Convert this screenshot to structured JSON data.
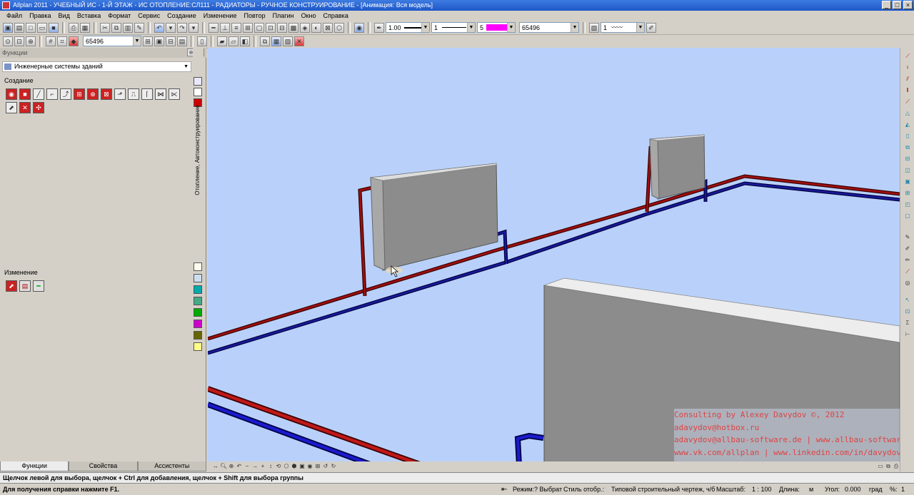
{
  "window": {
    "title": "Allplan 2011 - УЧЕБНЫЙ ИС - 1-Й ЭТАЖ - ИС ОТОПЛЕНИЕ:СЛ111 - РАДИАТОРЫ - РУЧНОЕ КОНСТРУИРОВАНИЕ - [Анимация: Вся модель]",
    "minimize": "_",
    "maximize": "□",
    "close": "×"
  },
  "menu": [
    "Файл",
    "Правка",
    "Вид",
    "Вставка",
    "Формат",
    "Сервис",
    "Создание",
    "Изменение",
    "Повтор",
    "Плагин",
    "Окно",
    "Справка"
  ],
  "toolbar1": {
    "pen_thickness": "1.00",
    "line_type": "1",
    "color_index": "5",
    "layer_value": "65496",
    "hatch_value": "1",
    "color_swatch": "#ff00ff"
  },
  "toolbar2": {
    "fixed_value": "65496"
  },
  "panel": {
    "header": "Функции",
    "module": "Инженерные системы зданий",
    "section_create": "Создание",
    "section_modify": "Изменение",
    "vertical_tab": "Отопление, Автоконструирование"
  },
  "bottom_tabs": [
    "Функции",
    "Свойства",
    "Ассистенты"
  ],
  "prompt": "Щелчок левой для выбора, щелчок + Ctrl для добавления, щелчок + Shift для выбора группы",
  "status": {
    "help": "Для получения справки нажмите F1.",
    "mode_label": "Режим:",
    "mode_value": "? Выбрат",
    "style_label": "Стиль отобр.:",
    "style_value": "Типовой строительный чертеж, ч/б",
    "scale_label": "Масштаб:",
    "scale_value": "1 : 100",
    "length_label": "Длина:",
    "length_unit": "м",
    "angle_label": "Угол:",
    "angle_value": "0.000",
    "angle_unit": "град",
    "percent_label": "%:",
    "percent_value": "1"
  },
  "watermark": {
    "line1": "Consulting by Alexey Davydov ©, 2012",
    "line2": "adavydov@hotbox.ru",
    "line3": "adavydov@allbau-software.de | www.allbau-software.de",
    "line4": "www.vk.com/allplan | www.linkedin.com/in/davydovalexey"
  },
  "colors": {
    "viewport_bg": "#b9d1fa",
    "supply_pipe": "#c00000",
    "return_pipe": "#00008b",
    "radiator": "#8c8c8c"
  }
}
